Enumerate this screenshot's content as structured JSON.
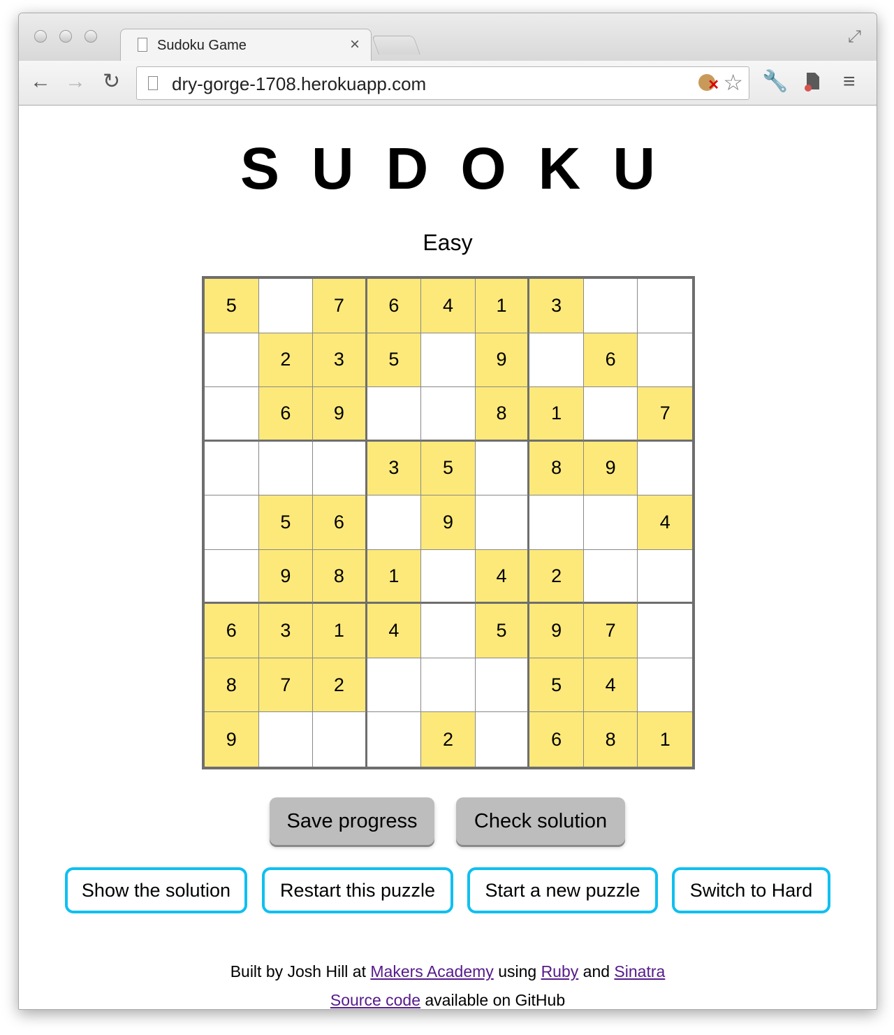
{
  "browser": {
    "tab_title": "Sudoku Game",
    "tab_close": "×",
    "url": "dry-gorge-1708.herokuapp.com",
    "back": "←",
    "forward": "→",
    "reload": "↻",
    "star": "☆",
    "wrench": "🔧",
    "menu": "≡",
    "fullscreen": "⤢"
  },
  "page": {
    "heading": "SUDOKU",
    "difficulty": "Easy",
    "buttons": {
      "save": "Save progress",
      "check": "Check solution",
      "show": "Show the solution",
      "restart": "Restart this puzzle",
      "new": "Start a new puzzle",
      "switch": "Switch to Hard"
    },
    "footer": {
      "built_by": "Built by Josh Hill at",
      "makers": "Makers Academy",
      "using": "using",
      "ruby": "Ruby",
      "and": "and",
      "sinatra": "Sinatra",
      "source": "Source code",
      "available": "available on GitHub"
    }
  },
  "colors": {
    "given_cell": "#fde97a",
    "grid_border": "#6e6e6e",
    "action_button_border": "#10bff0",
    "grey_button": "#bdbdbd",
    "link": "#551a8b"
  },
  "board": [
    [
      "5",
      "",
      "7",
      "6",
      "4",
      "1",
      "3",
      "",
      ""
    ],
    [
      "",
      "2",
      "3",
      "5",
      "",
      "9",
      "",
      "6",
      ""
    ],
    [
      "",
      "6",
      "9",
      "",
      "",
      "8",
      "1",
      "",
      "7"
    ],
    [
      "",
      "",
      "",
      "3",
      "5",
      "",
      "8",
      "9",
      ""
    ],
    [
      "",
      "5",
      "6",
      "",
      "9",
      "",
      "",
      "",
      "4"
    ],
    [
      "",
      "9",
      "8",
      "1",
      "",
      "4",
      "2",
      "",
      ""
    ],
    [
      "6",
      "3",
      "1",
      "4",
      "",
      "5",
      "9",
      "7",
      ""
    ],
    [
      "8",
      "7",
      "2",
      "",
      "",
      "",
      "5",
      "4",
      ""
    ],
    [
      "9",
      "",
      "",
      "",
      "2",
      "",
      "6",
      "8",
      "1"
    ]
  ]
}
